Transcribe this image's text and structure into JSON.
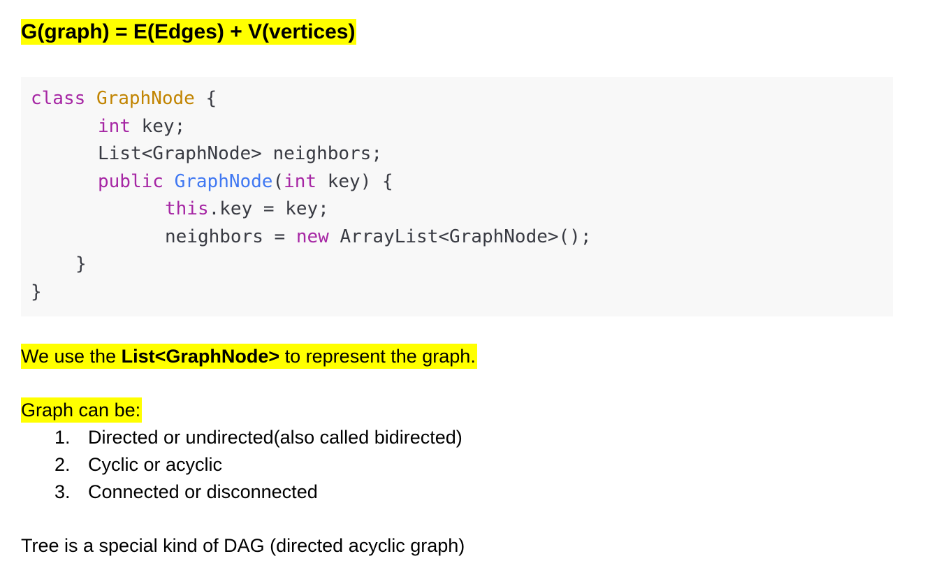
{
  "heading": "G(graph) = E(Edges) + V(vertices)",
  "code": {
    "line1": {
      "kw": "class",
      "type": "GraphNode",
      "rest": " {"
    },
    "line2": {
      "kw": "int",
      "rest": " key;"
    },
    "line3": {
      "text": "List<GraphNode> neighbors;"
    },
    "line4": {
      "kw1": "public",
      "fn": "GraphNode",
      "punct": "(",
      "kw2": "int",
      "rest": " key) {"
    },
    "line5": {
      "kw": "this",
      "rest": ".key = key;"
    },
    "line6": {
      "pre": "neighbors = ",
      "kw": "new",
      "rest": " ArrayList<GraphNode>();"
    },
    "line7": {
      "text": "}"
    },
    "line8": {
      "text": "}"
    }
  },
  "para1": {
    "before": "We use the ",
    "bold": "List<GraphNode>",
    "after": " to represent the graph."
  },
  "list_intro": "Graph can be:",
  "list_items": [
    {
      "num": "1.",
      "text": "Directed or undirected(also called bidirected)"
    },
    {
      "num": "2.",
      "text": "Cyclic or acyclic"
    },
    {
      "num": "3.",
      "text": "Connected or disconnected"
    }
  ],
  "tree_note": "Tree is a special kind of DAG (directed acyclic graph)"
}
